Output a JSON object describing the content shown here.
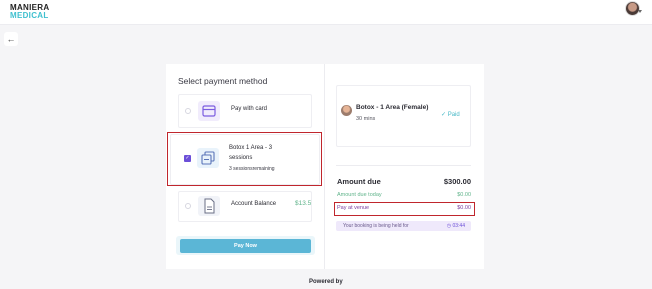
{
  "header": {
    "brand_line1": "MANIERA",
    "brand_line2": "MEDICAL"
  },
  "nav": {
    "back_icon": "←"
  },
  "payment": {
    "title": "Select payment method",
    "options": [
      {
        "label": "Pay with card",
        "icon": "card-icon"
      },
      {
        "label_line1": "Botox 1 Area - 3",
        "label_line2": "sessions",
        "sub": "3 sessionsremaining",
        "icon": "sessions-icon",
        "checked": true
      },
      {
        "label": "Account Balance",
        "amount": "$13.5",
        "icon": "document-icon"
      }
    ],
    "pay_button": "Pay Now"
  },
  "summary": {
    "service_title": "Botox - 1 Area (Female)",
    "duration": "30 mins",
    "status": "Paid",
    "amount_due_label": "Amount due",
    "amount_due": "$300.00",
    "due_today_label": "Amount due today",
    "due_today": "$0.00",
    "venue_label": "Pay at venue",
    "venue_amount": "$0.00",
    "held_text": "Your booking is being held for",
    "held_timer": "03:44"
  },
  "footer": {
    "powered": "Powered by"
  },
  "colors": {
    "accent": "#6c4fd8",
    "teal": "#3fc0cf",
    "highlight": "#c0262d",
    "pay_button": "#5bb6d6"
  }
}
